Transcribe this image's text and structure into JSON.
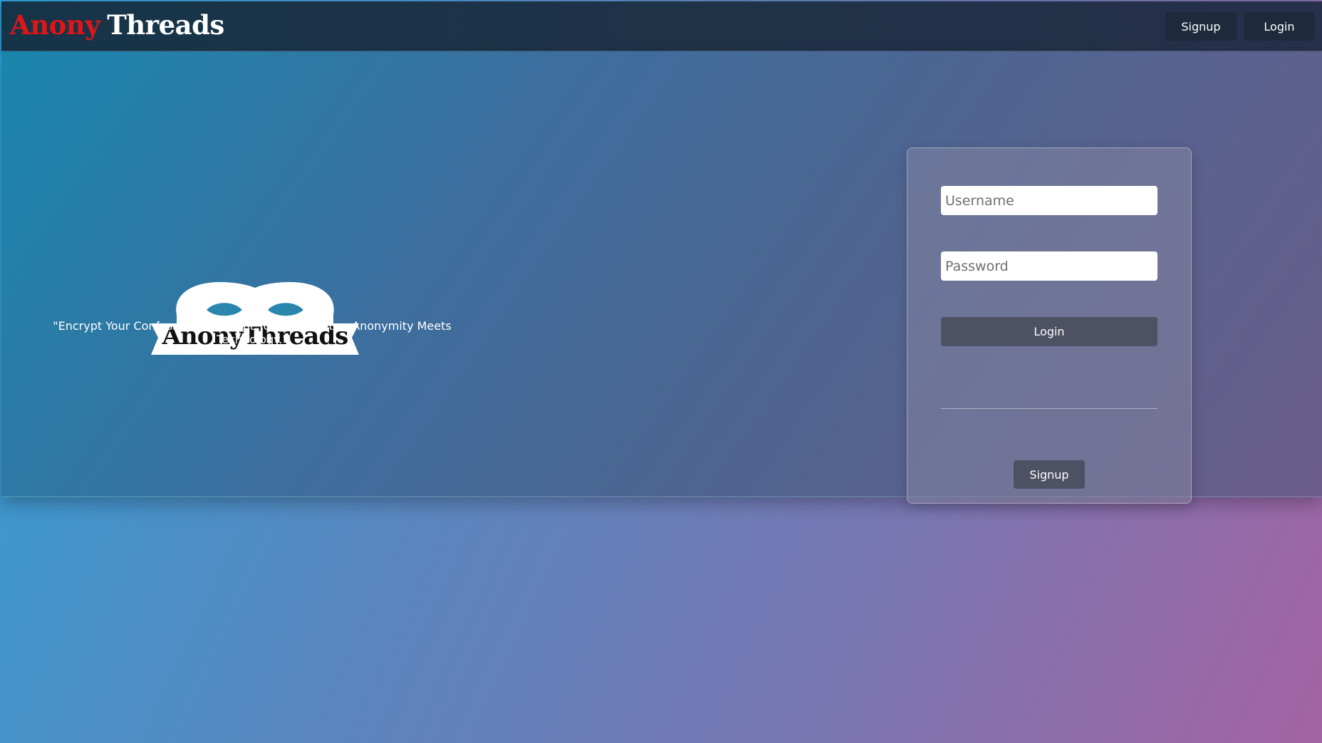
{
  "header": {
    "brand_part1": "Anony",
    "brand_part2": "Threads",
    "signup_label": "Signup",
    "login_label": "Login"
  },
  "hero": {
    "logo_text": "AnonyThreads",
    "tagline": "\"Encrypt Your Confessions, Decrypt Your Thoughts – Anonymity Meets Technology.\""
  },
  "login_form": {
    "username_placeholder": "Username",
    "password_placeholder": "Password",
    "login_button": "Login",
    "signup_button": "Signup"
  },
  "colors": {
    "brand_red": "#e01616",
    "nav_button_bg": "#1d2a3b",
    "form_button_bg": "#4d5163"
  },
  "icons": {
    "logo": "mask-logo-icon"
  }
}
